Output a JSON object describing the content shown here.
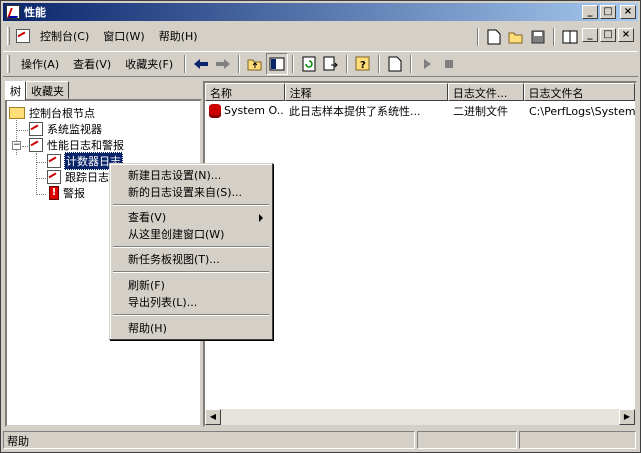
{
  "window": {
    "title": "性能",
    "min_label": "_",
    "max_label": "□",
    "close_label": "×"
  },
  "menubar": {
    "items": [
      "控制台(C)",
      "窗口(W)",
      "帮助(H)"
    ]
  },
  "toolbar": {
    "items": [
      "操作(A)",
      "查看(V)",
      "收藏夹(F)"
    ]
  },
  "left_tabs": [
    "树",
    "收藏夹"
  ],
  "tree": {
    "root": "控制台根节点",
    "system_monitor": "系统监视器",
    "perf_logs": "性能日志和警报",
    "counter_logs": "计数器日志",
    "trace_logs": "跟踪日志",
    "alerts": "警报"
  },
  "list": {
    "columns": [
      "名称",
      "注释",
      "日志文件...",
      "日志文件名"
    ],
    "rows": [
      {
        "name": "System O...",
        "comment": "此日志样本提供了系统性...",
        "type": "二进制文件",
        "file": "C:\\PerfLogs\\System..."
      }
    ]
  },
  "context_menu": {
    "items": [
      "新建日志设置(N)...",
      "新的日志设置来自(S)...",
      "查看(V)",
      "从这里创建窗口(W)",
      "新任务板视图(T)...",
      "刷新(F)",
      "导出列表(L)...",
      "帮助(H)"
    ]
  },
  "status": {
    "text": "帮助"
  }
}
